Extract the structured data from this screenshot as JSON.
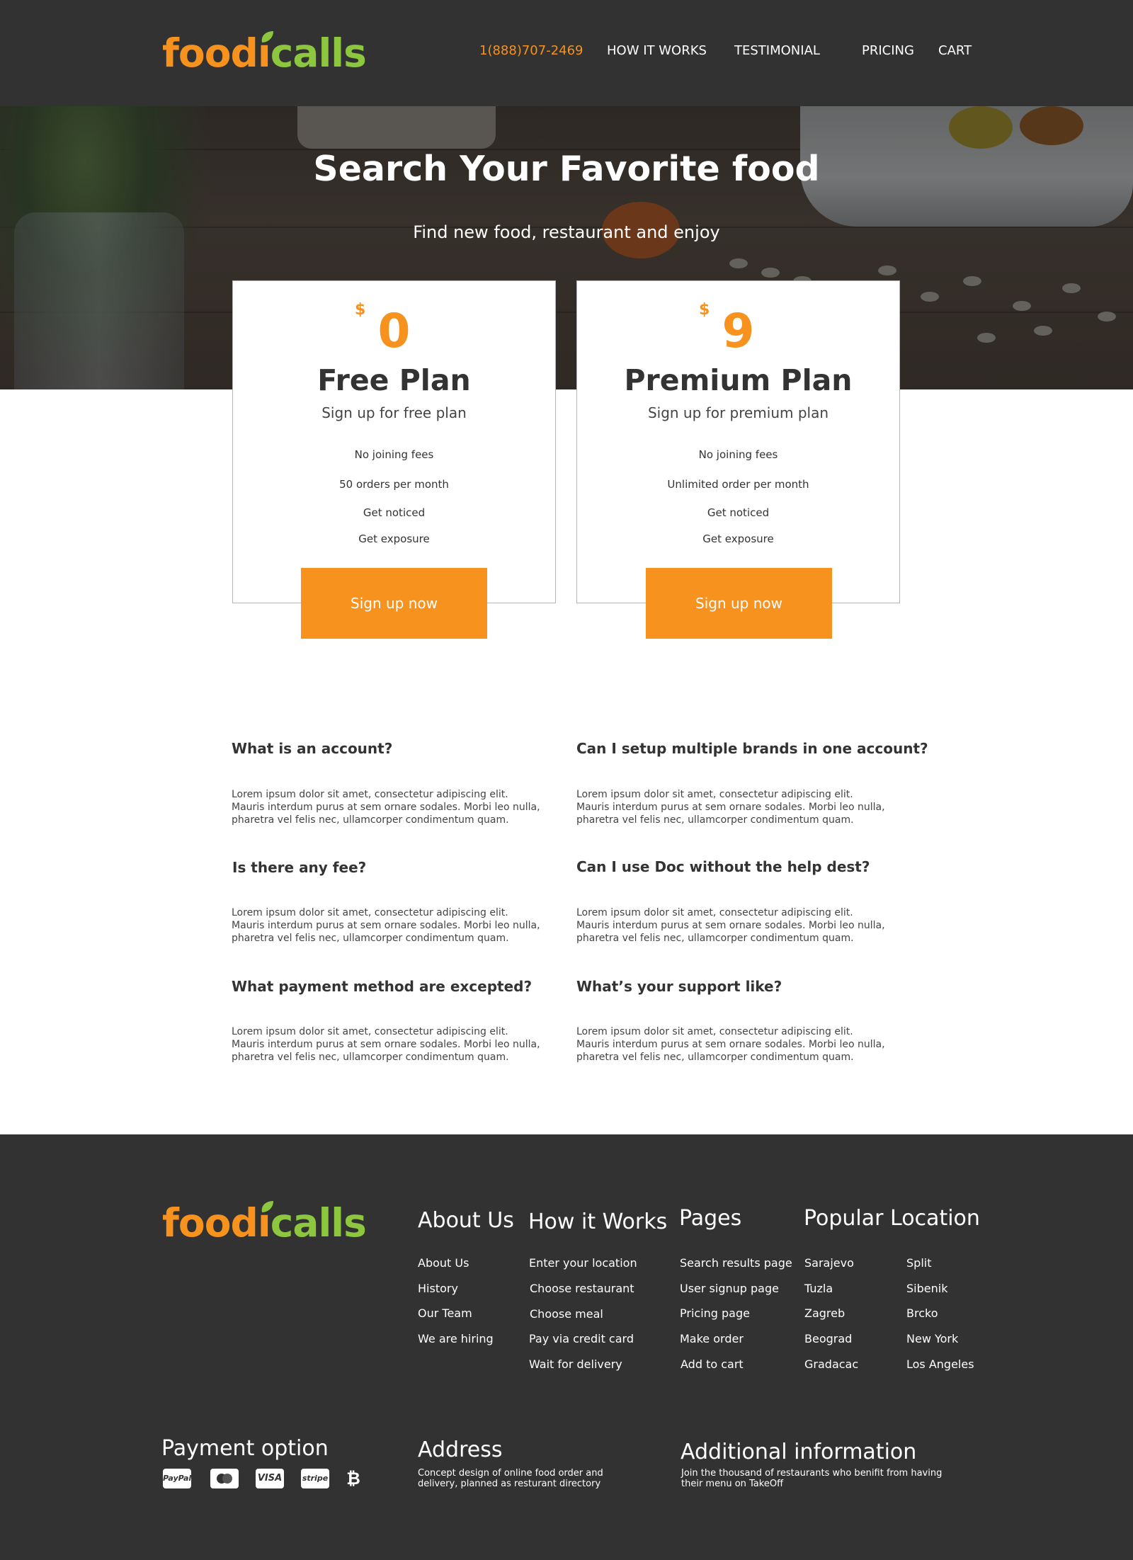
{
  "brand": {
    "name_part1": "food",
    "name_part2": "ca",
    "name_part3": "lls",
    "name_full": "foodiecalls",
    "accent_orange": "#f7921e",
    "accent_green": "#8dc63f",
    "dark_bg": "#323232"
  },
  "nav": {
    "phone": "1(888)707-2469",
    "items": [
      "HOW IT WORKS",
      "TESTIMONIAL",
      "PRICING",
      "CART"
    ]
  },
  "hero": {
    "title": "Search Your Favorite food",
    "subtitle": "Find new food, restaurant and enjoy"
  },
  "plans": [
    {
      "currency": "$",
      "price": "0",
      "name": "Free Plan",
      "subtitle": "Sign up for free plan",
      "features": [
        "No joining fees",
        "50 orders per month",
        "Get noticed",
        "Get exposure"
      ],
      "button": "Sign up now"
    },
    {
      "currency": "$",
      "price": "9",
      "name": "Premium Plan",
      "subtitle": "Sign up for premium plan",
      "features": [
        "No joining fees",
        "Unlimited order per month",
        "Get noticed",
        "Get exposure"
      ],
      "button": "Sign up now"
    }
  ],
  "faq": [
    {
      "question": "What is an account?",
      "answer": "Lorem ipsum dolor sit amet, consectetur adipiscing elit. Mauris  interdum purus at sem ornare sodales.  Morbi leo nulla,  pharetra vel felis nec, ullamcorper  condimentum quam."
    },
    {
      "question": "Can I setup multiple brands in one account?",
      "answer": "Lorem ipsum dolor sit amet, consectetur adipiscing elit. Mauris  interdum purus at sem ornare sodales.  Morbi leo nulla,  pharetra vel felis nec, ullamcorper  condimentum quam."
    },
    {
      "question": "Is there any fee?",
      "answer": "Lorem ipsum dolor sit amet, consectetur adipiscing elit. Mauris  interdum purus at sem ornare sodales.  Morbi leo nulla,  pharetra vel felis nec, ullamcorper  condimentum quam."
    },
    {
      "question": "Can I use Doc without the help dest?",
      "answer": "Lorem ipsum dolor sit amet, consectetur adipiscing elit. Mauris  interdum purus at sem ornare sodales.  Morbi leo nulla,  pharetra vel felis nec, ullamcorper  condimentum quam."
    },
    {
      "question": "What payment method are excepted?",
      "answer": "Lorem ipsum dolor sit amet, consectetur adipiscing elit. Mauris  interdum purus at sem ornare sodales.  Morbi leo nulla,  pharetra vel felis nec, ullamcorper  condimentum quam."
    },
    {
      "question": "What’s your support like?",
      "answer": "Lorem ipsum dolor sit amet, consectetur adipiscing elit. Mauris  interdum purus at sem ornare sodales.  Morbi leo nulla,  pharetra vel felis nec, ullamcorper  condimentum quam."
    }
  ],
  "footer": {
    "about": {
      "heading": "About Us",
      "links": [
        "About Us",
        "History",
        "Our Team",
        "We are hiring"
      ]
    },
    "how": {
      "heading": "How it Works",
      "links": [
        "Enter your location",
        "Choose restaurant",
        "Choose meal",
        "Pay via credit card",
        "Wait for delivery"
      ]
    },
    "pages": {
      "heading": "Pages",
      "links": [
        "Search results page",
        "User signup page",
        "Pricing page",
        "Make order",
        "Add to cart"
      ]
    },
    "locations": {
      "heading": "Popular Location",
      "col1": [
        "Sarajevo",
        "Tuzla",
        "Zagreb",
        "Beograd",
        "Gradacac"
      ],
      "col2": [
        "Split",
        "Sibenik",
        "Brcko",
        "New York",
        "Los Angeles"
      ]
    },
    "payment": {
      "heading": "Payment option",
      "methods": [
        "PayPal",
        "mastercard",
        "VISA",
        "stripe",
        "bitcoin"
      ],
      "labels": [
        "PayPal",
        "VISA",
        "stripe",
        "₿"
      ]
    },
    "address": {
      "heading": "Address",
      "text": "Concept design of online food order and delivery, planned as resturant directory"
    },
    "additional": {
      "heading": "Additional information",
      "text": "Join the thousand of restaurants who benifit from having their menu on TakeOff"
    }
  }
}
